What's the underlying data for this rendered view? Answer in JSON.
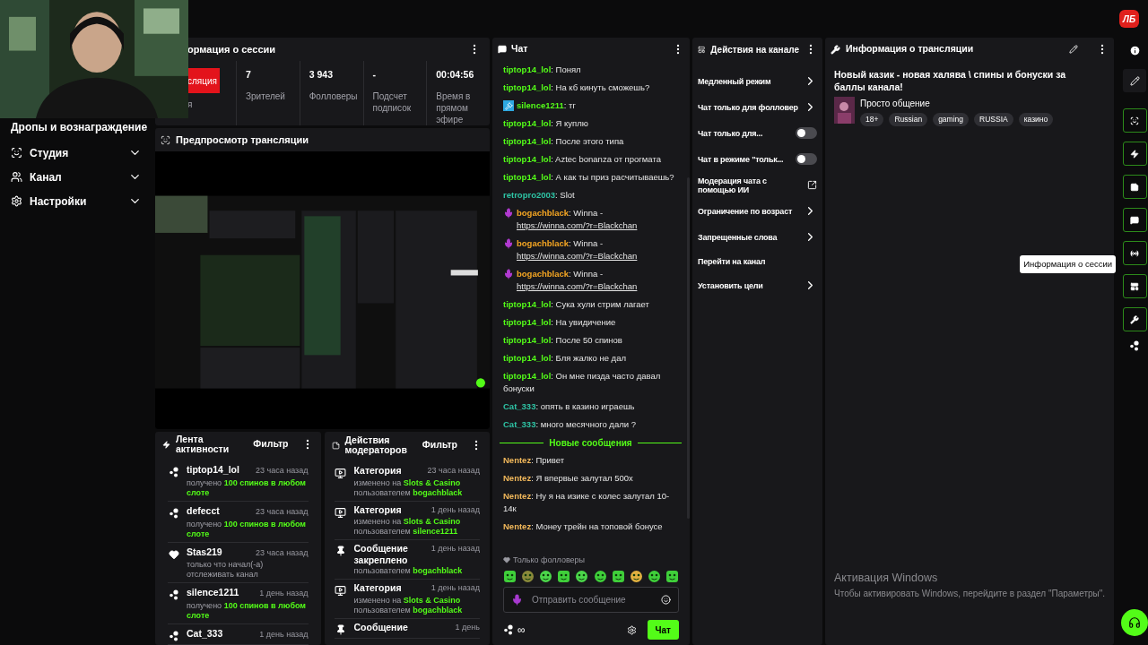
{
  "logo": {
    "text": "ЛБ"
  },
  "sidebar": {
    "partial_item": "Дропы и вознаграждение",
    "items": [
      {
        "label": "Студия",
        "expanded": false
      },
      {
        "label": "Канал",
        "expanded": false
      },
      {
        "label": "Настройки",
        "expanded": false
      }
    ]
  },
  "session_info": {
    "title": "ормация о сессии",
    "live_badge": "сляция",
    "live_label": "я",
    "stats": [
      {
        "value": "7",
        "label": "Зрителей"
      },
      {
        "value": "3 943",
        "label": "Фолловеры"
      },
      {
        "value": "-",
        "label": "Подсчет подписок"
      },
      {
        "value": "00:04:56",
        "label": "Время в прямом эфире"
      }
    ]
  },
  "preview": {
    "title": "Предпросмотр трансляции",
    "kind": "picture"
  },
  "activity_feed": {
    "title": "Лента активности",
    "filter": "Фильтр",
    "items": [
      {
        "kind": "reward",
        "user": "tiptop14_lol",
        "time": "23 часа назад",
        "text": "получено",
        "highlight": "100 спинов в любом слоте"
      },
      {
        "kind": "reward",
        "user": "defecct",
        "time": "23 часа назад",
        "text": "получено",
        "highlight": "100 спинов в любом слоте"
      },
      {
        "kind": "follow",
        "user": "Stas219",
        "time": "23 часа назад",
        "text": "только что начал(-а) отслеживать канал"
      },
      {
        "kind": "reward",
        "user": "silence1211",
        "time": "1 день назад",
        "text": "получено",
        "highlight": "100 спинов в любом слоте"
      },
      {
        "kind": "reward",
        "user": "Cat_333",
        "time": "1 день назад"
      }
    ]
  },
  "mod_actions": {
    "title": "Действия модераторов",
    "filter": "Фильтр",
    "items": [
      {
        "kind": "category",
        "title": "Категория",
        "time": "23 часа назад",
        "change": "изменено на",
        "value": "Slots & Casino",
        "by": "пользователем",
        "user": "bogachblack"
      },
      {
        "kind": "category",
        "title": "Категория",
        "time": "1 день назад",
        "change": "изменено на",
        "value": "Slots & Casino",
        "by": "пользователем",
        "user": "silence1211"
      },
      {
        "kind": "pin",
        "title": "Сообщение закреплено",
        "time": "1 день назад",
        "by": "пользователем",
        "user": "bogachblack"
      },
      {
        "kind": "category",
        "title": "Категория",
        "time": "1 день назад",
        "change": "изменено на",
        "value": "Slots & Casino",
        "by": "пользователем",
        "user": "bogachblack"
      },
      {
        "kind": "pin",
        "title": "Сообщение",
        "time": "1 день"
      }
    ]
  },
  "chat": {
    "title": "Чат",
    "messages": [
      {
        "kind": "message",
        "user": "tiptop14_lol",
        "color": "#53fc18",
        "text": ": Понял"
      },
      {
        "kind": "message",
        "user": "tiptop14_lol",
        "color": "#53fc18",
        "text": ": На кб кинуть сможешь?"
      },
      {
        "kind": "moderator",
        "user": "silence1211",
        "color": "#53fc18",
        "text": ": тг"
      },
      {
        "kind": "message",
        "user": "tiptop14_lol",
        "color": "#53fc18",
        "text": ": Я куплю"
      },
      {
        "kind": "message",
        "user": "tiptop14_lol",
        "color": "#53fc18",
        "text": ": После этого типа"
      },
      {
        "kind": "message",
        "user": "tiptop14_lol",
        "color": "#53fc18",
        "text": ": Aztec bonanza от прогмата"
      },
      {
        "kind": "message",
        "user": "tiptop14_lol",
        "color": "#53fc18",
        "text": ": А как ты приз расчитываешь?"
      },
      {
        "kind": "message",
        "user": "retropro2003",
        "color": "#2ec4a5",
        "text": ": Slot"
      },
      {
        "kind": "broadcaster",
        "user": "bogachblack",
        "color": "#f5a623",
        "text": ": Winna -",
        "link": "https://winna.com/?r=Blackchan"
      },
      {
        "kind": "broadcaster",
        "user": "bogachblack",
        "color": "#f5a623",
        "text": ": Winna -",
        "link": "https://winna.com/?r=Blackchan"
      },
      {
        "kind": "broadcaster",
        "user": "bogachblack",
        "color": "#f5a623",
        "text": ": Winna -",
        "link": "https://winna.com/?r=Blackchan"
      },
      {
        "kind": "message",
        "user": "tiptop14_lol",
        "color": "#53fc18",
        "text": ": Сука хули стрим лагает"
      },
      {
        "kind": "message",
        "user": "tiptop14_lol",
        "color": "#53fc18",
        "text": ": На увидичение"
      },
      {
        "kind": "message",
        "user": "tiptop14_lol",
        "color": "#53fc18",
        "text": ": После 50 спинов"
      },
      {
        "kind": "message",
        "user": "tiptop14_lol",
        "color": "#53fc18",
        "text": ": Бля жалко не дал"
      },
      {
        "kind": "message",
        "user": "tiptop14_lol",
        "color": "#53fc18",
        "text": ": Он мне пизда часто давал бонуски"
      },
      {
        "kind": "message",
        "user": "Cat_333",
        "color": "#2ec4a5",
        "text": ": опять в казино играешь"
      },
      {
        "kind": "message",
        "user": "Cat_333",
        "color": "#2ec4a5",
        "text": ": много месячного дали ?"
      },
      {
        "kind": "divider",
        "text": "Новые сообщения"
      },
      {
        "kind": "message",
        "user": "Nentez",
        "color": "#f0b75a",
        "text": ": Привет"
      },
      {
        "kind": "message",
        "user": "Nentez",
        "color": "#f0b75a",
        "text": ": Я впервые залутал 500х"
      },
      {
        "kind": "message",
        "user": "Nentez",
        "color": "#f0b75a",
        "text": ": Ну я на изике с колес залутал 10-14к"
      },
      {
        "kind": "message",
        "user": "Nentez",
        "color": "#f0b75a",
        "text": ": Монеу трейн на топовой бонусе"
      }
    ],
    "followers_only": "Только фолловеры",
    "input": {
      "placeholder": "Отправить сообщение"
    },
    "points": "∞",
    "send": "Чат"
  },
  "channel_actions": {
    "title": "Действия на канале",
    "items": [
      {
        "kind": "link",
        "label": "Медленный режим"
      },
      {
        "kind": "link",
        "label": "Чат только для фолловер"
      },
      {
        "kind": "toggle",
        "label": "Чат только для...",
        "on": false
      },
      {
        "kind": "toggle",
        "label": "Чат в режиме \"тольк...",
        "on": false
      },
      {
        "kind": "external",
        "label": "Модерация чата с помощью ИИ"
      },
      {
        "kind": "link",
        "label": "Ограничение по возраст"
      },
      {
        "kind": "link",
        "label": "Запрещенные слова"
      },
      {
        "kind": "plain",
        "label": "Перейти на канал"
      },
      {
        "kind": "link",
        "label": "Установить цели"
      }
    ]
  },
  "stream_info": {
    "title": "Информация о трансляции",
    "stream_title": "Новый казик - новая халява \\ спины и бонуски за баллы канала!",
    "category": "Просто общение",
    "tags": [
      "18+",
      "Russian",
      "gaming",
      "RUSSIA",
      "казино"
    ]
  },
  "rail": {
    "tooltip": "Информация о сессии"
  },
  "windows_notice": {
    "title": "Активация Windows",
    "text": "Чтобы активировать Windows, перейдите в раздел \"Параметры\"."
  }
}
